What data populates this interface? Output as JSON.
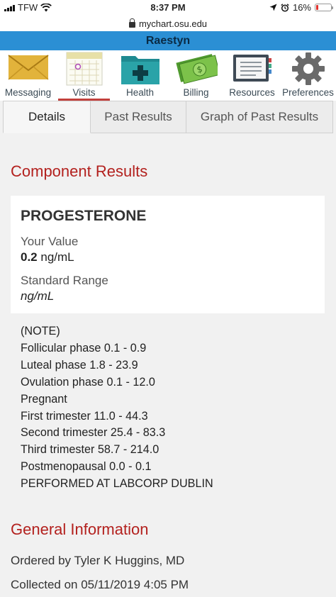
{
  "status_bar": {
    "carrier": "TFW",
    "time": "8:37 PM",
    "battery": "16%",
    "battery_level": 0.16
  },
  "url_bar": {
    "url": "mychart.osu.edu"
  },
  "header": {
    "title": "Raestyn"
  },
  "nav": [
    {
      "label": "Messaging",
      "icon": "envelope-icon"
    },
    {
      "label": "Visits",
      "icon": "calendar-icon"
    },
    {
      "label": "Health",
      "icon": "medical-folder-icon"
    },
    {
      "label": "Billing",
      "icon": "money-icon"
    },
    {
      "label": "Resources",
      "icon": "binder-icon"
    },
    {
      "label": "Preferences",
      "icon": "gear-icon"
    }
  ],
  "tabs": [
    {
      "label": "Details",
      "active": true
    },
    {
      "label": "Past Results",
      "active": false
    },
    {
      "label": "Graph of Past Results",
      "active": false
    }
  ],
  "component_results": {
    "heading": "Component Results",
    "name": "PROGESTERONE",
    "your_value_label": "Your Value",
    "value": "0.2",
    "value_unit": "ng/mL",
    "standard_range_label": "Standard Range",
    "standard_range_unit": "ng/mL"
  },
  "notes": [
    "(NOTE)",
    "Follicular phase 0.1 - 0.9",
    "Luteal phase 1.8 - 23.9",
    "Ovulation phase 0.1 - 12.0",
    "Pregnant",
    "First trimester 11.0 - 44.3",
    "Second trimester 25.4 - 83.3",
    "Third trimester 58.7 - 214.0",
    "Postmenopausal 0.0 - 0.1",
    "PERFORMED AT LABCORP DUBLIN"
  ],
  "general_information": {
    "heading": "General Information",
    "ordered_by": "Ordered by Tyler K Huggins, MD",
    "collected_on": "Collected on 05/11/2019 4:05 PM"
  },
  "colors": {
    "header_blue": "#2b8fd4",
    "accent_red": "#b3211e"
  }
}
